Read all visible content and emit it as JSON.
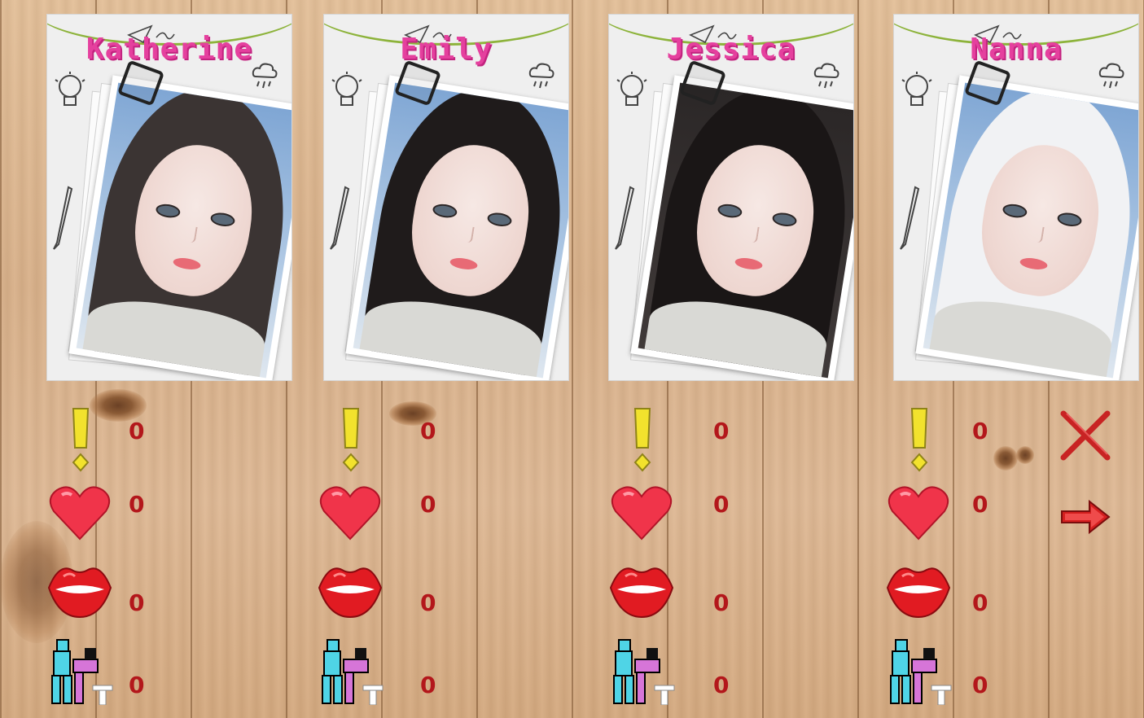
{
  "characters": [
    {
      "name": "Katherine",
      "alert": "0",
      "love": "0",
      "kiss": "0",
      "sex": "0",
      "hair": "#3b3433",
      "sky": true
    },
    {
      "name": "Emily",
      "alert": "0",
      "love": "0",
      "kiss": "0",
      "sex": "0",
      "hair": "#1f1b1b",
      "sky": true
    },
    {
      "name": "Jessica",
      "alert": "0",
      "love": "0",
      "kiss": "0",
      "sex": "0",
      "hair": "#1a1616",
      "sky": false
    },
    {
      "name": "Nanna",
      "alert": "0",
      "love": "0",
      "kiss": "0",
      "sex": "0",
      "hair": "#f1f2f4",
      "sky": true
    }
  ],
  "icons": {
    "alert": "exclamation-icon",
    "love": "heart-icon",
    "kiss": "lips-icon",
    "sex": "couple-icon",
    "close": "close-x-icon",
    "next": "arrow-right-icon"
  },
  "colors": {
    "name": "#e5409e",
    "value": "#b3171b",
    "string": "#8db33b",
    "close": "#c82323",
    "arrow": "#d51f1f"
  }
}
